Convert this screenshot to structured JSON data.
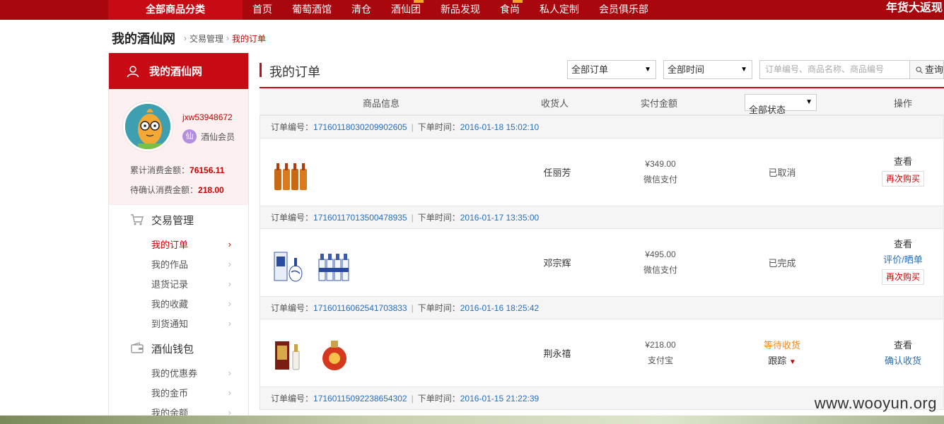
{
  "topnav": {
    "all_categories": "全部商品分类",
    "items": [
      "首页",
      "葡萄酒馆",
      "清仓",
      "酒仙团",
      "新品发现",
      "食尚",
      "私人定制",
      "会员俱乐部"
    ],
    "promo": "年货大返现"
  },
  "breadcrumb": {
    "site": "我的酒仙网",
    "section": "交易管理",
    "current": "我的订单"
  },
  "sidebar": {
    "header": "我的酒仙网",
    "user": {
      "username": "jxw53948672",
      "level_badge": "仙",
      "level": "酒仙会员",
      "total_label": "累计消费金额：",
      "total_value": "76156.11",
      "pending_label": "待确认消费金额：",
      "pending_value": "218.00"
    },
    "sections": [
      {
        "title": "交易管理",
        "items": [
          "我的订单",
          "我的作品",
          "退货记录",
          "我的收藏",
          "到货通知"
        ]
      },
      {
        "title": "酒仙钱包",
        "items": [
          "我的优惠券",
          "我的金币",
          "我的余额"
        ]
      }
    ],
    "arrow": "›"
  },
  "main": {
    "title": "我的订单",
    "filter_orders": "全部订单",
    "filter_time": "全部时间",
    "search_placeholder": "订单编号、商品名称、商品编号",
    "search_button": "查询",
    "dropdown_arrow": "▼",
    "table_headers": {
      "goods": "商品信息",
      "receiver": "收货人",
      "amount": "实付金额",
      "status": "全部状态",
      "ops": "操作"
    },
    "order_no_label": "订单编号：",
    "order_time_label": "下单时间：",
    "divider": "|",
    "orders": [
      {
        "number": "17160118030209902605",
        "time": "2016-01-18 15:02:10",
        "receiver": "任丽芳",
        "amount": "¥349.00",
        "payment": "微信支付",
        "status": "已取消",
        "view": "查看",
        "rebuy": "再次购买"
      },
      {
        "number": "17160117013500478935",
        "time": "2016-01-17 13:35:00",
        "receiver": "邓宗辉",
        "amount": "¥495.00",
        "payment": "微信支付",
        "status": "已完成",
        "view": "查看",
        "review": "评价/晒单",
        "rebuy": "再次购买"
      },
      {
        "number": "17160116062541703833",
        "time": "2016-01-16 18:25:42",
        "receiver": "荆永禧",
        "amount": "¥218.00",
        "payment": "支付宝",
        "status": "等待收货",
        "track": "跟踪",
        "view": "查看",
        "confirm": "确认收货"
      },
      {
        "number": "17160115092238654302",
        "time": "2016-01-15 21:22:39"
      }
    ]
  },
  "watermark": "www.wooyun.org",
  "colors": {
    "brand_red": "#c70b14",
    "nav_red": "#a8070e",
    "link_blue": "#2a6ebb",
    "wait_orange": "#f08a24"
  }
}
